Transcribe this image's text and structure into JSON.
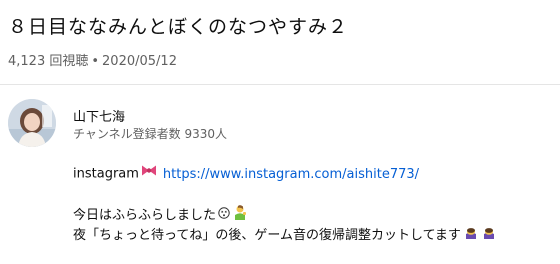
{
  "video": {
    "title": "８日目ななみんとぼくのなつやすみ２",
    "views": "4,123 回視聴",
    "separator": "•",
    "date": "2020/05/12"
  },
  "channel": {
    "name": "山下七海",
    "subscribers": "チャンネル登録者数 9330人",
    "avatar_icon": "channel-avatar"
  },
  "description": {
    "instagram_label": "instagram",
    "instagram_emoji": "ribbon-icon",
    "instagram_url": "https://www.instagram.com/aishite773/",
    "line2": "今日はふらふらしました",
    "line2_emojis": [
      "dizzy-face-icon",
      "person-tipping-hand-icon"
    ],
    "line3": "夜「ちょっと待ってね」の後、ゲーム音の復帰調整カットしてます",
    "line3_emojis": [
      "person-bowing-icon",
      "person-bowing-icon"
    ]
  },
  "colors": {
    "link": "#065fd4",
    "text_primary": "#0f0f0f",
    "text_secondary": "#606060",
    "divider": "#e5e5e5",
    "ribbon": "#e0457b"
  }
}
